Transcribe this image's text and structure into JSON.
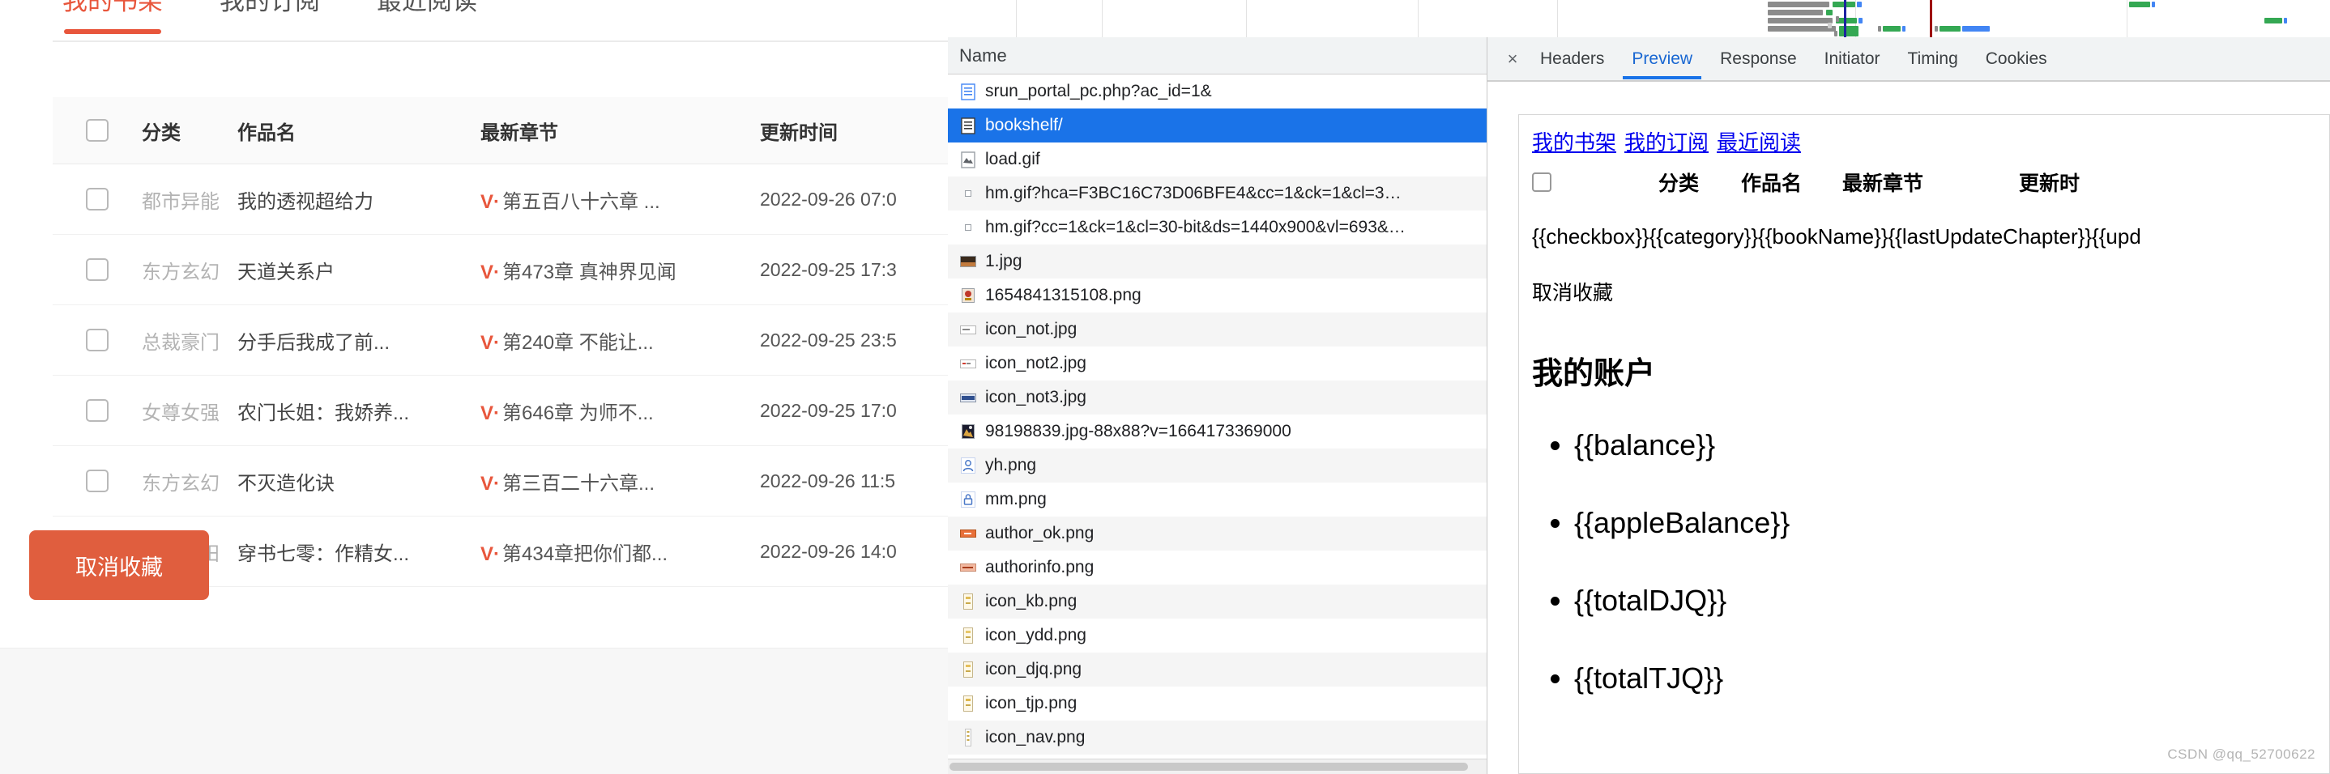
{
  "bookshelf": {
    "tabs": [
      {
        "label": "我的书架",
        "active": true
      },
      {
        "label": "我的订阅",
        "active": false
      },
      {
        "label": "最近阅读",
        "active": false
      }
    ],
    "accent_color": "#e8563c",
    "table": {
      "headers": [
        "分类",
        "作品名",
        "最新章节",
        "更新时间"
      ],
      "rows": [
        {
          "category": "都市异能",
          "bookName": "我的透视超给力",
          "chapterFlag": "V·",
          "chapter": "第五百八十六章 ...",
          "updateTime": "2022-09-26 07:0"
        },
        {
          "category": "东方玄幻",
          "bookName": "天道关系户",
          "chapterFlag": "V·",
          "chapter": "第473章 真神界见闻",
          "updateTime": "2022-09-25 17:3"
        },
        {
          "category": "总裁豪门",
          "bookName": "分手后我成了前...",
          "chapterFlag": "V·",
          "chapter": "第240章 不能让...",
          "updateTime": "2022-09-25 23:5"
        },
        {
          "category": "女尊女强",
          "bookName": "农门长姐：我娇养...",
          "chapterFlag": "V·",
          "chapter": "第646章 为师不...",
          "updateTime": "2022-09-25 17:0"
        },
        {
          "category": "东方玄幻",
          "bookName": "不灭造化诀",
          "chapterFlag": "V·",
          "chapter": "第三百二十六章...",
          "updateTime": "2022-09-26 11:5"
        },
        {
          "category": "年代种田",
          "bookName": "穿书七零：作精女...",
          "chapterFlag": "V·",
          "chapter": "第434章把你们都...",
          "updateTime": "2022-09-26 14:0"
        }
      ]
    },
    "cancel_button": "取消收藏",
    "cancel_button_color": "#e05e3e"
  },
  "devtools": {
    "network": {
      "column_header": "Name",
      "files": [
        {
          "name": "srun_portal_pc.php?ac_id=1&",
          "icon": "document-icon",
          "selected": false
        },
        {
          "name": "bookshelf/",
          "icon": "document-icon",
          "selected": true
        },
        {
          "name": "load.gif",
          "icon": "broken-image-icon",
          "selected": false
        },
        {
          "name": "hm.gif?hca=F3BC16C73D06BFE4&cc=1&ck=1&cl=3…",
          "icon": "tiny-pixel-icon",
          "selected": false
        },
        {
          "name": "hm.gif?cc=1&ck=1&cl=30-bit&ds=1440x900&vl=693&…",
          "icon": "tiny-pixel-icon",
          "selected": false
        },
        {
          "name": "1.jpg",
          "icon": "image-thumb-icon",
          "selected": false
        },
        {
          "name": "1654841315108.png",
          "icon": "image-thumb-icon",
          "selected": false
        },
        {
          "name": "icon_not.jpg",
          "icon": "image-thumb-icon",
          "selected": false
        },
        {
          "name": "icon_not2.jpg",
          "icon": "image-thumb-icon",
          "selected": false
        },
        {
          "name": "icon_not3.jpg",
          "icon": "image-thumb-icon",
          "selected": false
        },
        {
          "name": "98198839.jpg-88x88?v=1664173369000",
          "icon": "image-thumb-icon",
          "selected": false
        },
        {
          "name": "yh.png",
          "icon": "person-icon",
          "selected": false
        },
        {
          "name": "mm.png",
          "icon": "lock-icon",
          "selected": false
        },
        {
          "name": "author_ok.png",
          "icon": "image-thumb-icon",
          "selected": false
        },
        {
          "name": "authorinfo.png",
          "icon": "image-thumb-icon",
          "selected": false
        },
        {
          "name": "icon_kb.png",
          "icon": "image-thumb-icon",
          "selected": false
        },
        {
          "name": "icon_ydd.png",
          "icon": "image-thumb-icon",
          "selected": false
        },
        {
          "name": "icon_djq.png",
          "icon": "image-thumb-icon",
          "selected": false
        },
        {
          "name": "icon_tjp.png",
          "icon": "image-thumb-icon",
          "selected": false
        },
        {
          "name": "icon_nav.png",
          "icon": "image-thumb-icon",
          "selected": false
        }
      ]
    },
    "detail": {
      "close_label": "×",
      "tabs": [
        {
          "label": "Headers",
          "active": false
        },
        {
          "label": "Preview",
          "active": true
        },
        {
          "label": "Response",
          "active": false
        },
        {
          "label": "Initiator",
          "active": false
        },
        {
          "label": "Timing",
          "active": false
        },
        {
          "label": "Cookies",
          "active": false
        }
      ],
      "active_tab_color": "#1a73e8",
      "preview": {
        "links": [
          "我的书架",
          "我的订阅",
          "最近阅读"
        ],
        "table_headers": [
          "分类",
          "作品名",
          "最新章节",
          "更新时"
        ],
        "template_row": "{{checkbox}}{{category}}{{bookName}}{{lastUpdateChapter}}{{upd",
        "cancel_text": "取消收藏",
        "account_heading": "我的账户",
        "account_items": [
          "{{balance}}",
          "{{appleBalance}}",
          "{{totalDJQ}}",
          "{{totalTJQ}}"
        ]
      }
    }
  },
  "watermark": "CSDN @qq_52700622"
}
